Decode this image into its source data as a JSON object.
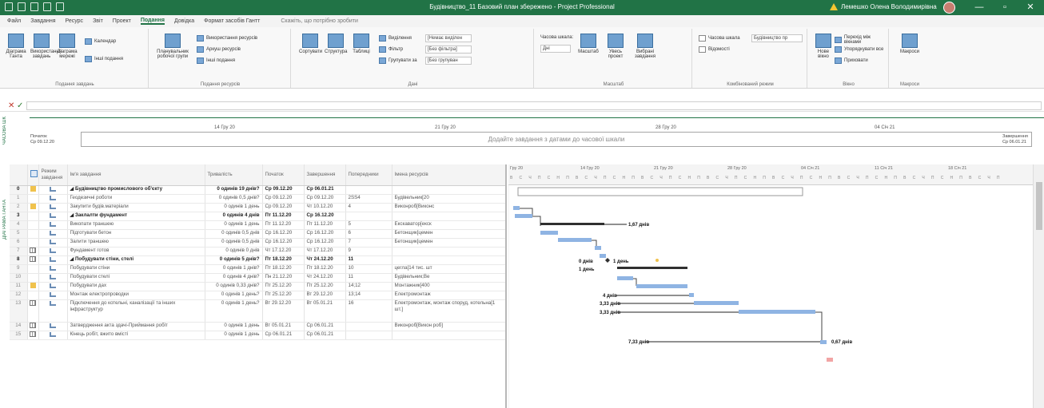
{
  "titlebar": {
    "title": "Будівництво_11 Базовий план збережено - Project Professional",
    "user_name": "Лемешко Олена Володимирівна",
    "min": "—",
    "max": "▫",
    "close": "✕"
  },
  "ribbon": {
    "tabs": [
      "Файл",
      "Завдання",
      "Ресурс",
      "Звіт",
      "Проект",
      "Подання",
      "Довідка",
      "Формат засобів Гантт",
      "Скажіть, що потрібно зробити"
    ],
    "active_tab": "Подання",
    "groups": {
      "task_views": {
        "label": "Подання завдань",
        "gantt": "Діаграма Ганта",
        "usage": "Використання завдань",
        "network": "Діаграма мережі",
        "calendar": "Календар",
        "other": "Інші подання"
      },
      "resource_views": {
        "label": "Подання ресурсів",
        "planner": "Планувальник робочої групи",
        "usage": "Використання ресурсів",
        "sheet": "Аркуш ресурсів",
        "other": "Інші подання"
      },
      "data": {
        "label": "Дані",
        "sort": "Сортувати",
        "outline": "Структура",
        "tables": "Таблиці",
        "highlight": "Виділення",
        "filter": "Фільтр",
        "group": "Групувати за",
        "highlight_value": "[Немає виділен",
        "filter_value": "[Без фільтра]",
        "group_value": "[Без групуван"
      },
      "zoom": {
        "label": "Масштаб",
        "timescale": "Часова шкала:",
        "timescale_value": "Дні",
        "zoom": "Масштаб",
        "entire": "Увесь проект",
        "selected": "Вибрані завдання"
      },
      "split": {
        "label": "Комбінований режим",
        "timeline_check": "Часова шкала",
        "timeline_value": "Будівництво пр",
        "details_check": "Відомості"
      },
      "window": {
        "label": "Вікно",
        "new": "Нове вікно",
        "switch": "Перехід між вікнами",
        "arrange": "Упорядкувати все",
        "hide": "Приховати"
      },
      "macros": {
        "label": "Макроси",
        "macros": "Макроси"
      }
    }
  },
  "timeline": {
    "vlabel": "ЧАСОВА ШК",
    "start_label": "Початок",
    "start_date": "Ср 09.12.20",
    "end_label": "Завершення",
    "end_date": "Ср 06.01.21",
    "placeholder": "Додайте завдання з датами до часової шкали",
    "ticks": [
      "14 Гру 20",
      "21 Гру 20",
      "28 Гру 20",
      "04 Січ 21"
    ]
  },
  "gantt_vlabel": "ДІАГРАМА ГАНТА",
  "grid": {
    "headers": {
      "mode": "Режим завдання",
      "name": "Ім'я завдання",
      "duration": "Тривалість",
      "start": "Початок",
      "finish": "Завершення",
      "pred": "Попередники",
      "resources": "Імена ресурсів"
    },
    "rows": [
      {
        "id": "0",
        "name": "◢ Будівництво промислового об'єкту",
        "duration": "0 одинів 19 днів?",
        "start": "Ср 09.12.20",
        "finish": "Ср 06.01.21",
        "pred": "",
        "res": "",
        "summary": true,
        "ind": "note"
      },
      {
        "id": "1",
        "name": "Геодезичні роботи",
        "duration": "0 одинів 0,5 днів?",
        "start": "Ср 09.12.20",
        "finish": "Ср 09.12.20",
        "pred": "2SS4",
        "res": "Будівельник[20",
        "summary": false,
        "ind": ""
      },
      {
        "id": "2",
        "name": "Закупити будів.матеріали",
        "duration": "0 одинів 1 день",
        "start": "Ср 09.12.20",
        "finish": "Чт 10.12.20",
        "pred": "4",
        "res": "Виконроб[Виконс",
        "summary": false,
        "ind": "note"
      },
      {
        "id": "3",
        "name": "◢ Заклалти фундамент",
        "duration": "0 одинів 4 днів",
        "start": "Пт 11.12.20",
        "finish": "Ср 16.12.20",
        "pred": "",
        "res": "",
        "summary": true,
        "ind": ""
      },
      {
        "id": "4",
        "name": "Викопати траншею",
        "duration": "0 одинів 1 день",
        "start": "Пт 11.12.20",
        "finish": "Пт 11.12.20",
        "pred": "5",
        "res": "Екскаватор[екск",
        "summary": false,
        "ind": ""
      },
      {
        "id": "5",
        "name": "Підготувати бетон",
        "duration": "0 одинів 0,5 днів",
        "start": "Ср 16.12.20",
        "finish": "Ср 16.12.20",
        "pred": "6",
        "res": "Бетонщик[цемен",
        "summary": false,
        "ind": ""
      },
      {
        "id": "6",
        "name": "Залити траншею",
        "duration": "0 одинів 0,5 днів",
        "start": "Ср 16.12.20",
        "finish": "Ср 16.12.20",
        "pred": "7",
        "res": "Бетонщик[цемен",
        "summary": false,
        "ind": ""
      },
      {
        "id": "7",
        "name": "Фундамент готов",
        "duration": "0 одинів 0 днів",
        "start": "Чт 17.12.20",
        "finish": "Чт 17.12.20",
        "pred": "9",
        "res": "",
        "summary": false,
        "ind": "grid"
      },
      {
        "id": "8",
        "name": "◢ Побудувати стіни, стелі",
        "duration": "0 одинів 5 днів?",
        "start": "Пт 18.12.20",
        "finish": "Чт 24.12.20",
        "pred": "11",
        "res": "",
        "summary": true,
        "ind": "grid"
      },
      {
        "id": "9",
        "name": "Побудувати стіни",
        "duration": "0 одинів 1 днів?",
        "start": "Пт 18.12.20",
        "finish": "Пт 18.12.20",
        "pred": "10",
        "res": "цегла[14 тис. шт",
        "summary": false,
        "ind": ""
      },
      {
        "id": "10",
        "name": "Побудувати стелі",
        "duration": "0 одинів 4 днів?",
        "start": "Пн 21.12.20",
        "finish": "Чт 24.12.20",
        "pred": "11",
        "res": "Будівельник;Ве",
        "summary": false,
        "ind": ""
      },
      {
        "id": "11",
        "name": "Побудувати дах",
        "duration": "0 одинів 0,33 днів?",
        "start": "Пт 25.12.20",
        "finish": "Пт 25.12.20",
        "pred": "14;12",
        "res": "Монтажник[400",
        "summary": false,
        "ind": "note"
      },
      {
        "id": "12",
        "name": "Монтаж електропроводки",
        "duration": "0 одинів 1 день?",
        "start": "Пт 25.12.20",
        "finish": "Вт 29.12.20",
        "pred": "13;14",
        "res": "Електромонтаж",
        "summary": false,
        "ind": ""
      },
      {
        "id": "13",
        "name": "Підключення до котельні, каналізації та інших інфраструктур",
        "duration": "0 одинів 1 день?",
        "start": "Вт 29.12.20",
        "finish": "Вт 05.01.21",
        "pred": "16",
        "res": "Електромонтаж, монтаж споруд, котельна[1 шт.]",
        "summary": false,
        "ind": "grid"
      },
      {
        "id": "14",
        "name": "Затвердження акта здачі-Приймання робіт",
        "duration": "0 одинів 1 день",
        "start": "Вт 05.01.21",
        "finish": "Ср 06.01.21",
        "pred": "",
        "res": "Виконроб[Викон роб]",
        "summary": false,
        "ind": "grid"
      },
      {
        "id": "15",
        "name": "Кінець робіт, вжито вмісті",
        "duration": "0 одинів 1 день",
        "start": "Ср 06.01.21",
        "finish": "Ср 06.01.21",
        "pred": "",
        "res": "",
        "summary": false,
        "ind": "grid"
      }
    ]
  },
  "gantt": {
    "weeks": [
      "Гру 20",
      "14 Гру 20",
      "21 Гру 20",
      "28 Гру 20",
      "04 Січ 21",
      "11 Січ 21",
      "18 Січ 21"
    ],
    "days": "В С Ч П С Н П В С Ч П С Н П В С Ч П С Н П В С Ч П С Н П В С Ч П С Н П В С Ч П С Н П В С Ч П С Н П В С Ч П",
    "labels": {
      "l1": "1,67 днів",
      "l2": "0 днів",
      "l3": "1 день",
      "l4": "1 день",
      "l5": "4 днів",
      "l6": "3,33 днів",
      "l7": "3,33 днів",
      "l8": "7,33 днів",
      "l9": "0,67 днів"
    },
    "colors": {
      "bar": "#8fb4e3",
      "summary": "#303030",
      "slack": "#222",
      "milestone": "#303030"
    }
  }
}
